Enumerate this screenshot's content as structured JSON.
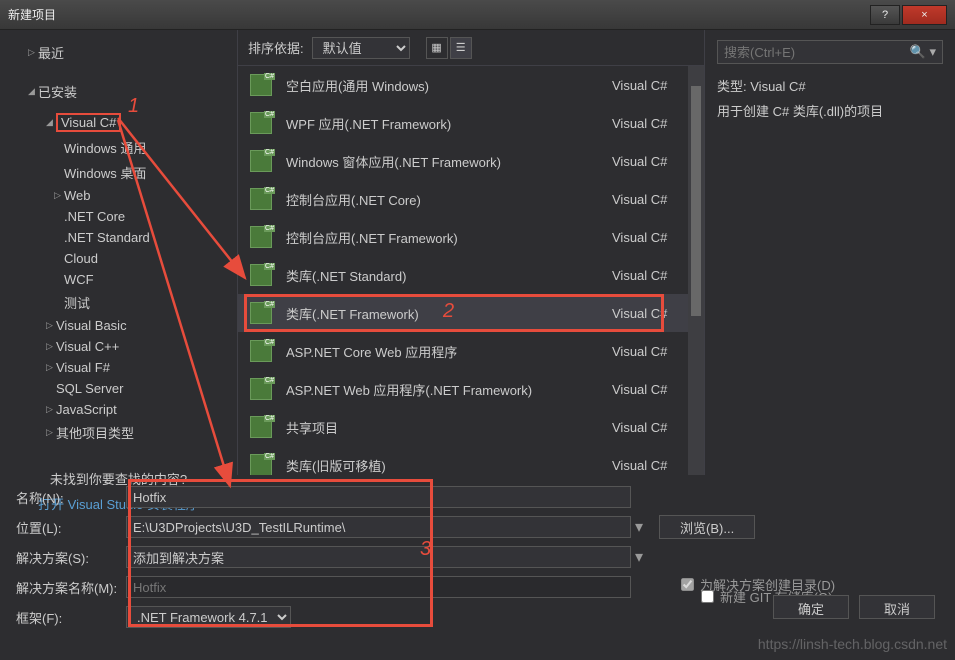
{
  "window": {
    "title": "新建项目",
    "help": "?",
    "close": "×"
  },
  "tree": {
    "recent": "最近",
    "installed": "已安装",
    "vcsharp": "Visual C#",
    "items": [
      "Windows 通用",
      "Windows 桌面",
      "Web",
      ".NET Core",
      ".NET Standard",
      "Cloud",
      "WCF",
      "测试"
    ],
    "vb": "Visual Basic",
    "vcpp": "Visual C++",
    "vfsharp": "Visual F#",
    "sql": "SQL Server",
    "js": "JavaScript",
    "other": "其他项目类型",
    "notfound": "未找到你要查找的内容?",
    "openinstaller": "打开 Visual Studio 安装程序"
  },
  "center": {
    "sortLabel": "排序依据:",
    "sortValue": "默认值",
    "templates": [
      {
        "name": "空白应用(通用 Windows)",
        "lang": "Visual C#"
      },
      {
        "name": "WPF 应用(.NET Framework)",
        "lang": "Visual C#"
      },
      {
        "name": "Windows 窗体应用(.NET Framework)",
        "lang": "Visual C#"
      },
      {
        "name": "控制台应用(.NET Core)",
        "lang": "Visual C#"
      },
      {
        "name": "控制台应用(.NET Framework)",
        "lang": "Visual C#"
      },
      {
        "name": "类库(.NET Standard)",
        "lang": "Visual C#"
      },
      {
        "name": "类库(.NET Framework)",
        "lang": "Visual C#"
      },
      {
        "name": "ASP.NET Core Web 应用程序",
        "lang": "Visual C#"
      },
      {
        "name": "ASP.NET Web 应用程序(.NET Framework)",
        "lang": "Visual C#"
      },
      {
        "name": "共享项目",
        "lang": "Visual C#"
      },
      {
        "name": "类库(旧版可移植)",
        "lang": "Visual C#"
      }
    ]
  },
  "right": {
    "searchPlaceholder": "搜索(Ctrl+E)",
    "typeLabel": "类型:",
    "typeValue": "Visual C#",
    "desc": "用于创建 C# 类库(.dll)的项目"
  },
  "form": {
    "nameLabel": "名称(N):",
    "nameValue": "Hotfix",
    "locLabel": "位置(L):",
    "locValue": "E:\\U3DProjects\\U3D_TestILRuntime\\",
    "slnLabel": "解决方案(S):",
    "slnValue": "添加到解决方案",
    "slnNameLabel": "解决方案名称(M):",
    "slnNameValue": "Hotfix",
    "fwLabel": "框架(F):",
    "fwValue": ".NET Framework 4.7.1",
    "browse": "浏览(B)...",
    "createDir": "为解决方案创建目录(D)",
    "newGit": "新建 GIT 存储库(G)",
    "ok": "确定",
    "cancel": "取消"
  },
  "annotations": {
    "n1": "1",
    "n2": "2",
    "n3": "3"
  },
  "watermark": "https://linsh-tech.blog.csdn.net"
}
